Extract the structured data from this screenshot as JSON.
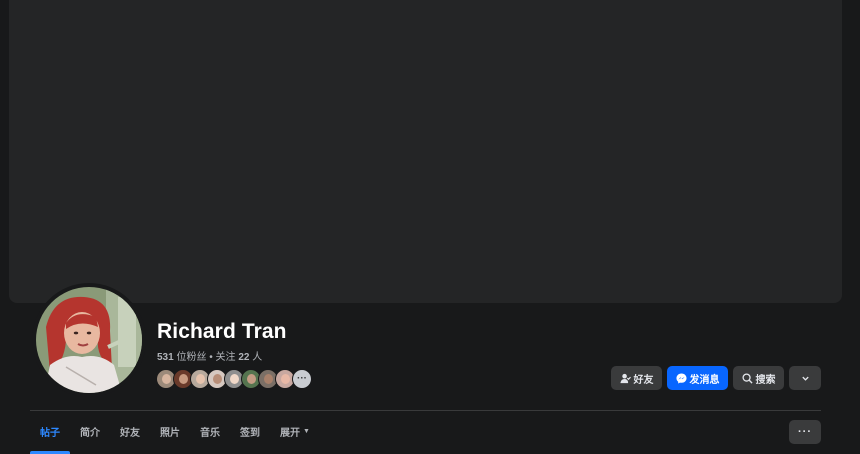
{
  "profile": {
    "name": "Richard Tran",
    "followers_count": "531",
    "followers_label": "位粉丝",
    "separator": "•",
    "following_label": "关注",
    "following_count": "22",
    "following_unit": "人"
  },
  "friends_preview": {
    "avatars": [
      "friend-1",
      "friend-2",
      "friend-3",
      "friend-4",
      "friend-5",
      "friend-6",
      "friend-7",
      "friend-8"
    ],
    "more_label": "···"
  },
  "actions": {
    "friends_label": "好友",
    "message_label": "发消息",
    "search_label": "搜索"
  },
  "tabs": [
    {
      "label": "帖子",
      "active": true
    },
    {
      "label": "简介"
    },
    {
      "label": "好友"
    },
    {
      "label": "照片"
    },
    {
      "label": "音乐"
    },
    {
      "label": "签到"
    },
    {
      "label": "展开"
    }
  ],
  "more_menu_label": "···",
  "colors": {
    "background": "#18191a",
    "cover": "#242526",
    "accent": "#0866ff",
    "active_tab": "#2d88ff",
    "button": "#3a3b3c"
  }
}
